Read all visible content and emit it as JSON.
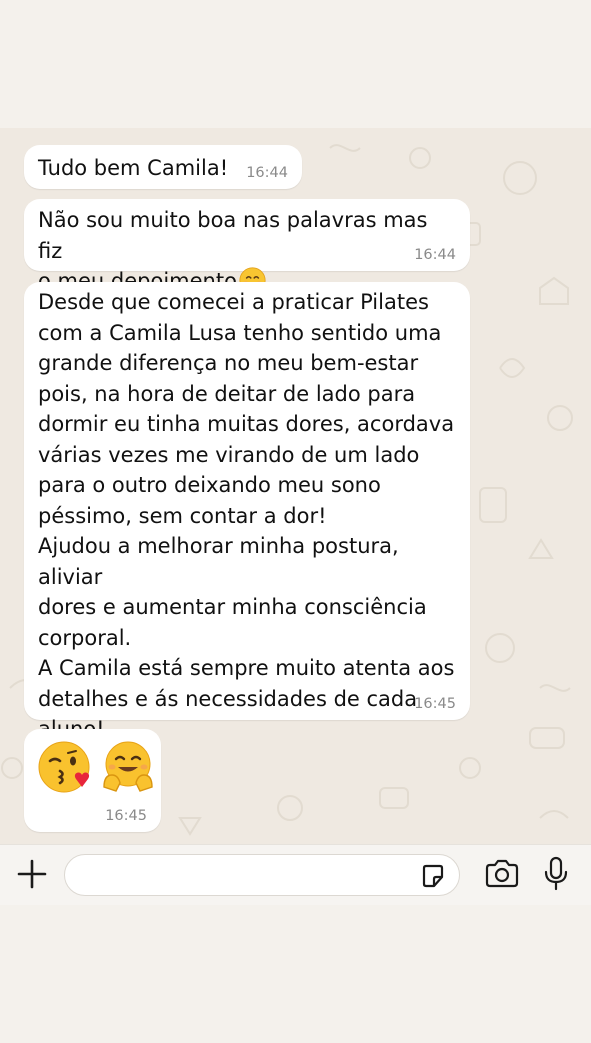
{
  "messages": [
    {
      "text": "Tudo bem Camila!",
      "time": "16:44"
    },
    {
      "text": "Não sou muito boa nas palavras mas fiz\no meu depoimento",
      "emoji": "smiling-face-icon",
      "time": "16:44"
    },
    {
      "text": "Desde que comecei a praticar Pilates\ncom a Camila Lusa tenho sentido uma\ngrande diferença no meu bem-estar\npois, na hora de deitar de lado para\ndormir eu tinha muitas dores, acordava\nvárias vezes me virando de um lado\npara o outro deixando meu sono\npéssimo, sem contar a dor!\nAjudou a melhorar minha postura, aliviar\ndores e aumentar minha consciência\ncorporal.\nA Camila está sempre muito atenta aos\ndetalhes e ás necessidades de cada\naluno!",
      "time": "16:45"
    },
    {
      "emojis": [
        "kissing-face-icon",
        "hugging-face-icon"
      ],
      "time": "16:45"
    }
  ],
  "composer": {
    "icons": [
      "plus-icon",
      "sticker-icon",
      "camera-icon",
      "microphone-icon"
    ]
  },
  "colors": {
    "chat_background": "#efe9e1",
    "bubble": "#ffffff",
    "time_text": "#8a8a8a",
    "page_background": "#f4f1ec"
  }
}
